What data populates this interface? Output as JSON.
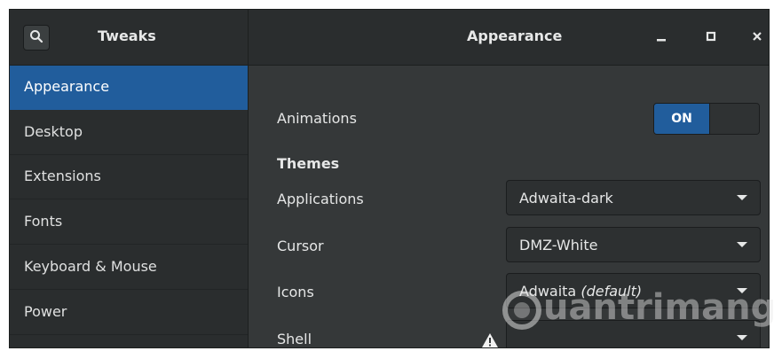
{
  "header": {
    "app_title": "Tweaks",
    "window_title": "Appearance",
    "icons": {
      "search": "search-icon",
      "minimize": "minimize-icon",
      "maximize": "maximize-icon",
      "close": "close-icon"
    }
  },
  "sidebar": {
    "items": [
      {
        "label": "Appearance",
        "selected": true
      },
      {
        "label": "Desktop"
      },
      {
        "label": "Extensions"
      },
      {
        "label": "Fonts"
      },
      {
        "label": "Keyboard & Mouse"
      },
      {
        "label": "Power"
      }
    ]
  },
  "content": {
    "animations_label": "Animations",
    "animations_toggle": "ON",
    "themes_heading": "Themes",
    "rows": [
      {
        "label": "Applications",
        "value": "Adwaita-dark"
      },
      {
        "label": "Cursor",
        "value": "DMZ-White"
      },
      {
        "label": "Icons",
        "value": "Adwaita",
        "value_suffix": "(default)"
      },
      {
        "label": "Shell",
        "value": ""
      }
    ],
    "shell_warning_icon": "warning-icon"
  },
  "watermark": {
    "text": "uantrimang",
    "brand_letter": "Q"
  },
  "colors": {
    "accent": "#215d9c",
    "background": "#353839",
    "sidebar": "#2a2d2e"
  }
}
